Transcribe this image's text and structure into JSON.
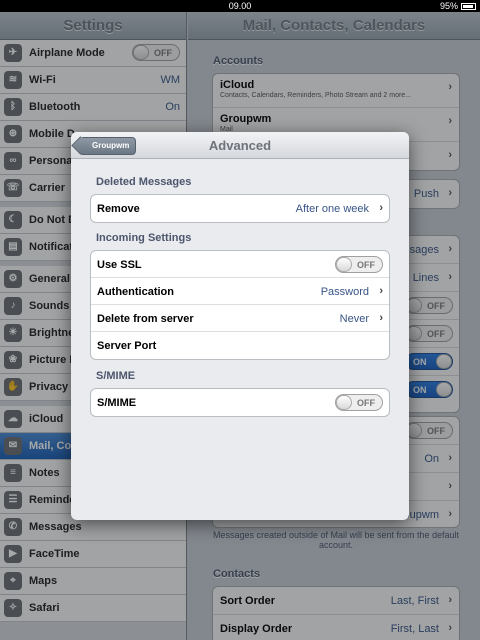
{
  "status_bar": {
    "time": "09.00",
    "battery": "95%"
  },
  "sidebar": {
    "title": "Settings",
    "items": [
      {
        "label": "Airplane Mode",
        "toggle": "OFF",
        "icon": "airplane-icon",
        "glyph": "✈"
      },
      {
        "label": "Wi-Fi",
        "value": "WM",
        "icon": "wifi-icon",
        "glyph": "≋"
      },
      {
        "label": "Bluetooth",
        "value": "On",
        "icon": "bluetooth-icon",
        "glyph": "ᛒ"
      },
      {
        "label": "Mobile D",
        "icon": "mobile-data-icon",
        "glyph": "⊕"
      },
      {
        "label": "Persona",
        "icon": "personal-hotspot-icon",
        "glyph": "∞"
      },
      {
        "label": "Carrier",
        "icon": "carrier-icon",
        "glyph": "☏"
      },
      {
        "label": "Do Not D",
        "icon": "moon-icon",
        "glyph": "☾"
      },
      {
        "label": "Notificat",
        "icon": "notifications-icon",
        "glyph": "▤"
      },
      {
        "label": "General",
        "icon": "gear-icon",
        "glyph": "⚙"
      },
      {
        "label": "Sounds",
        "icon": "speaker-icon",
        "glyph": "♪"
      },
      {
        "label": "Brightne",
        "icon": "brightness-icon",
        "glyph": "☀"
      },
      {
        "label": "Picture F",
        "icon": "picture-frame-icon",
        "glyph": "❀"
      },
      {
        "label": "Privacy",
        "icon": "privacy-hand-icon",
        "glyph": "✋"
      },
      {
        "label": "iCloud",
        "icon": "cloud-icon",
        "glyph": "☁"
      },
      {
        "label": "Mail, Co",
        "icon": "mail-icon",
        "glyph": "✉"
      },
      {
        "label": "Notes",
        "icon": "notes-icon",
        "glyph": "≡"
      },
      {
        "label": "Reminde",
        "icon": "reminders-icon",
        "glyph": "☰"
      },
      {
        "label": "Messages",
        "icon": "messages-icon",
        "glyph": "✆"
      },
      {
        "label": "FaceTime",
        "icon": "facetime-icon",
        "glyph": "▶"
      },
      {
        "label": "Maps",
        "icon": "maps-icon",
        "glyph": "⌖"
      },
      {
        "label": "Safari",
        "icon": "safari-icon",
        "glyph": "✧"
      }
    ]
  },
  "main": {
    "title": "Mail, Contacts, Calendars",
    "accounts_header": "Accounts",
    "accounts": [
      {
        "label": "iCloud",
        "sub": "Contacts, Calendars, Reminders, Photo Stream and 2 more..."
      },
      {
        "label": "Groupwm",
        "sub": "Mail"
      }
    ],
    "fetch_value": "Push",
    "peek_values": [
      "ssages",
      "2 Lines",
      "OFF",
      "OFF",
      "ON",
      "ON",
      "OFF",
      "On",
      "oupwm"
    ],
    "footer_text": "Messages created outside of Mail will be sent from the default account.",
    "contacts_header": "Contacts",
    "contacts_rows": [
      {
        "label": "Sort Order",
        "value": "Last, First"
      },
      {
        "label": "Display Order",
        "value": "First, Last"
      }
    ]
  },
  "popover": {
    "back_label": "Groupwm",
    "title": "Advanced",
    "deleted_header": "Deleted Messages",
    "remove_label": "Remove",
    "remove_value": "After one week",
    "incoming_header": "Incoming Settings",
    "use_ssl_label": "Use SSL",
    "use_ssl_state": "OFF",
    "auth_label": "Authentication",
    "auth_value": "Password",
    "delete_label": "Delete from server",
    "delete_value": "Never",
    "port_label": "Server Port",
    "smime_header": "S/MIME",
    "smime_label": "S/MIME",
    "smime_state": "OFF"
  }
}
